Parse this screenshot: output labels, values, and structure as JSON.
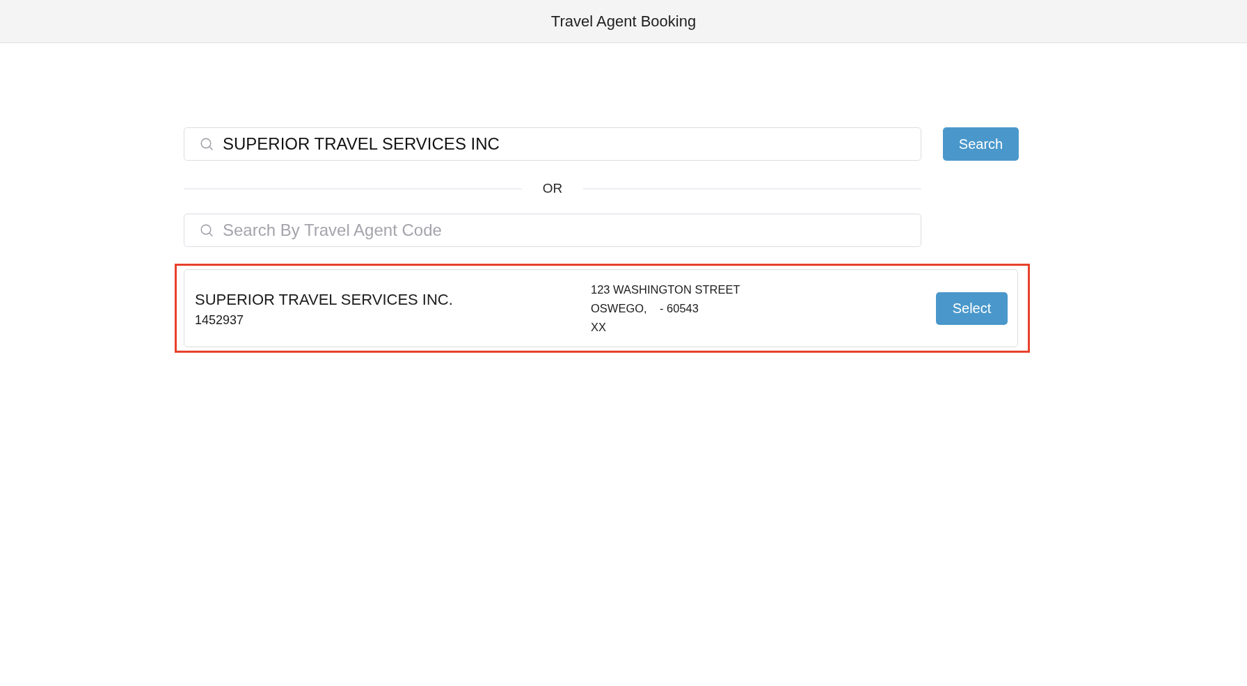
{
  "header": {
    "title": "Travel Agent Booking"
  },
  "search": {
    "name_field": {
      "value": "SUPERIOR TRAVEL SERVICES INC"
    },
    "button": "Search",
    "divider": "OR",
    "code_field": {
      "placeholder": "Search By Travel Agent Code"
    }
  },
  "results": [
    {
      "name": "SUPERIOR TRAVEL SERVICES INC.",
      "code": "1452937",
      "address_lines": [
        "123 WASHINGTON STREET",
        "OSWEGO,    - 60543",
        "XX"
      ],
      "highlighted": true,
      "button": "Select"
    }
  ]
}
